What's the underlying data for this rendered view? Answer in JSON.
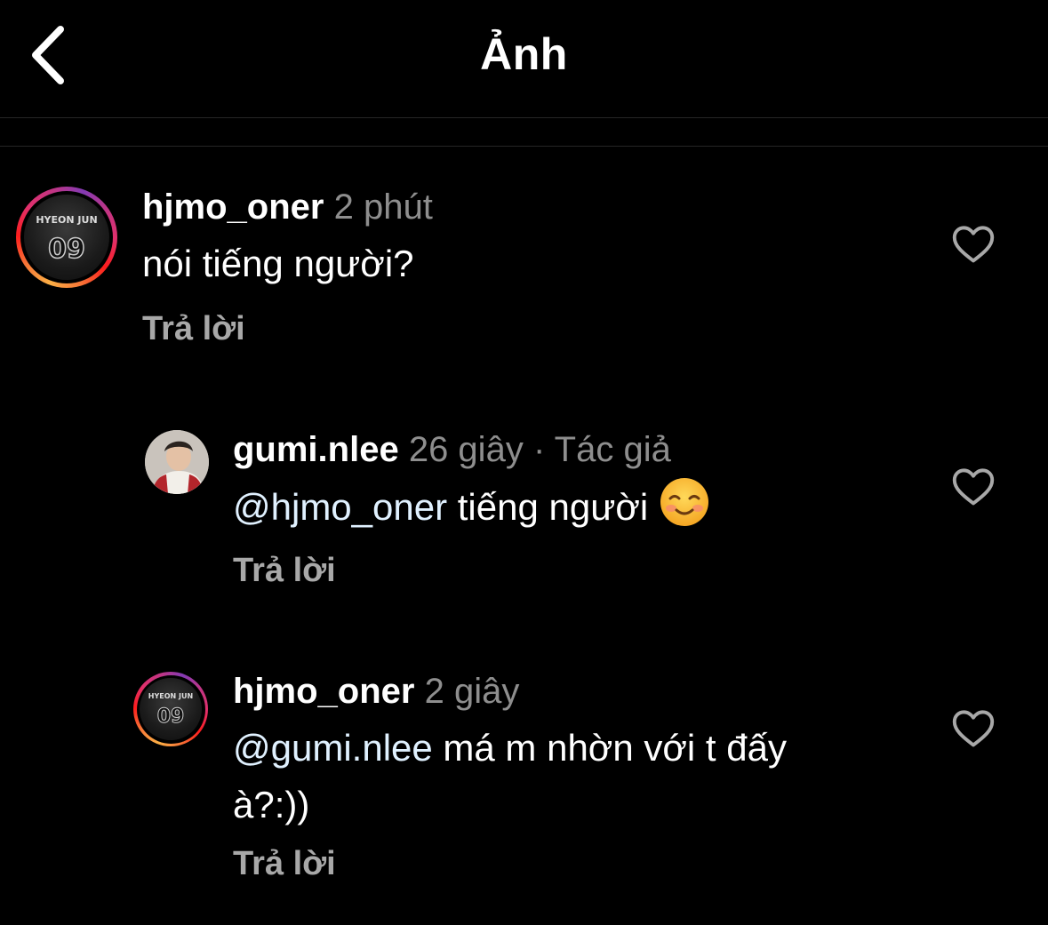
{
  "header": {
    "title": "Ảnh",
    "back_icon": "chevron-left-icon"
  },
  "comments": [
    {
      "username": "hjmo_oner",
      "time": "2 phút",
      "text": "nói tiếng người?",
      "reply_label": "Trả lời",
      "avatar": {
        "story_ring": true,
        "jersey_name": "HYEON JUN",
        "jersey_number": "09"
      }
    },
    {
      "username": "gumi.nlee",
      "time": "26 giây",
      "separator": "·",
      "author_badge": "Tác giả",
      "mention": "@hjmo_oner",
      "text": " tiếng người ",
      "emoji": "☺️",
      "reply_label": "Trả lời",
      "avatar": {
        "story_ring": false
      }
    },
    {
      "username": "hjmo_oner",
      "time": "2 giây",
      "mention": "@gumi.nlee",
      "text": " má m nhờn với t đấy",
      "text_line2": "à?:))",
      "reply_label": "Trả lời",
      "avatar": {
        "story_ring": true,
        "jersey_name": "HYEON JUN",
        "jersey_number": "09"
      }
    }
  ],
  "colors": {
    "background": "#000000",
    "meta_gray": "#8e8e8e",
    "reply_gray": "#a8a8a8",
    "mention": "#e0f1ff",
    "divider": "#262626"
  }
}
